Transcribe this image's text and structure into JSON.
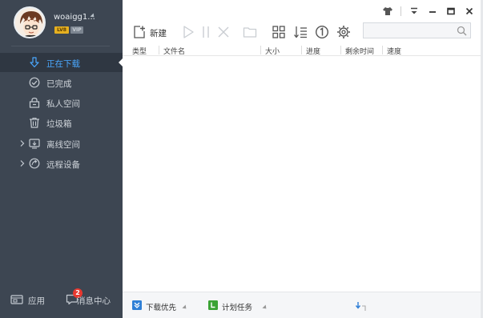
{
  "user": {
    "name": "woaigg1...",
    "level_badge": "LV8",
    "vip_badge": "VIP"
  },
  "sidebar": {
    "items": [
      {
        "label": "正在下载",
        "icon": "download-arrow-icon",
        "active": true,
        "expandable": false
      },
      {
        "label": "已完成",
        "icon": "check-circle-icon",
        "active": false,
        "expandable": false
      },
      {
        "label": "私人空间",
        "icon": "lock-icon",
        "active": false,
        "expandable": false
      },
      {
        "label": "垃圾箱",
        "icon": "trash-icon",
        "active": false,
        "expandable": false
      },
      {
        "label": "离线空间",
        "icon": "cloud-download-icon",
        "active": false,
        "expandable": true
      },
      {
        "label": "远程设备",
        "icon": "remote-device-icon",
        "active": false,
        "expandable": true
      }
    ],
    "bottom": {
      "apps_label": "应用",
      "messages_label": "消息中心",
      "message_count": "2"
    }
  },
  "toolbar": {
    "new_label": "新建",
    "search_placeholder": ""
  },
  "table": {
    "columns": [
      "类型",
      "文件名",
      "大小",
      "进度",
      "剩余时间",
      "速度"
    ]
  },
  "statusbar": {
    "priority_label": "下载优先",
    "schedule_label": "计划任务"
  },
  "colors": {
    "sidebar_bg": "#3d4652",
    "active_text": "#4aa8ff",
    "badge_red": "#e8382f",
    "schedule_green": "#3aa335",
    "priority_blue": "#2f7fd6"
  }
}
